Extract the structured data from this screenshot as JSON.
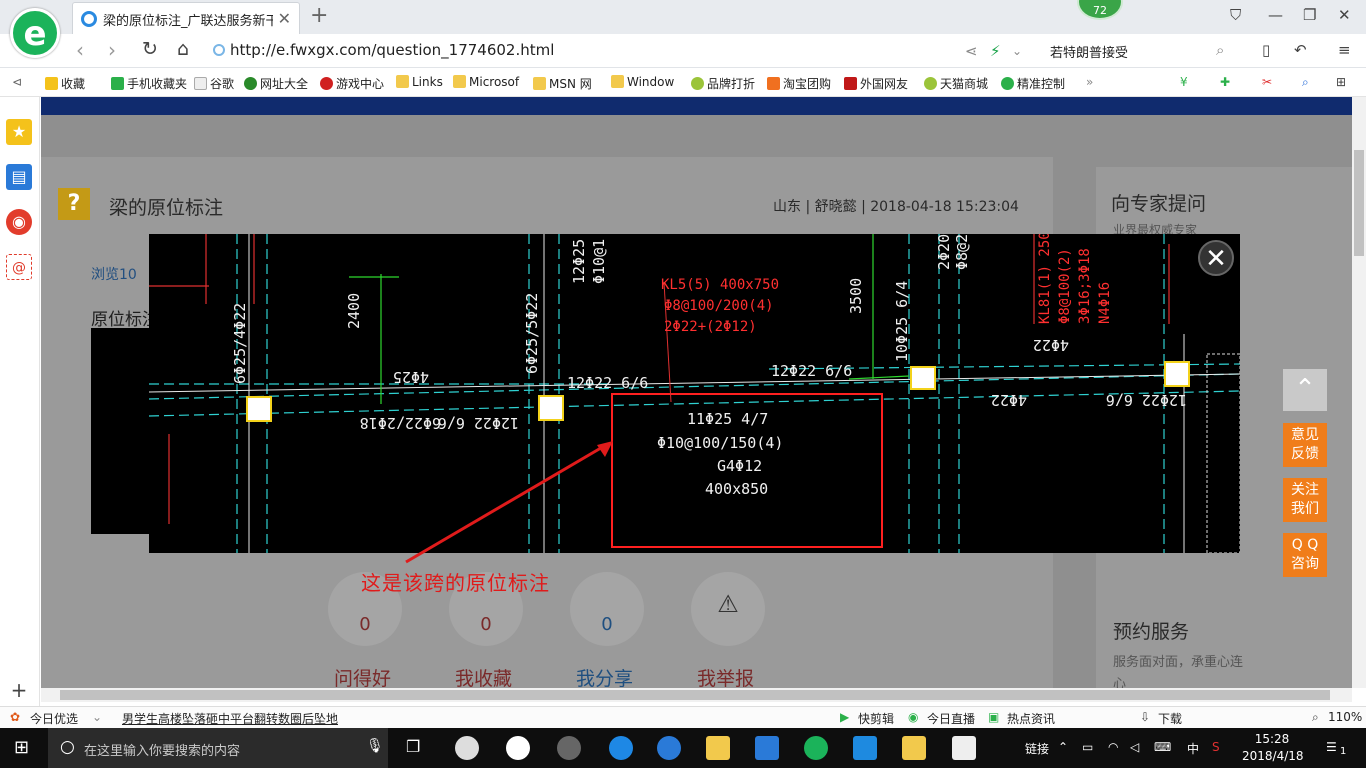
{
  "tab": {
    "title": "梁的原位标注_广联达服务新干线",
    "close": "✕",
    "new": "+"
  },
  "badge": "72",
  "address": {
    "url": "http://e.fwxgx.com/question_1774602.html",
    "search": "若特朗普接受"
  },
  "bookmarks": [
    "收藏",
    "手机收藏夹",
    "谷歌",
    "网址大全",
    "游戏中心",
    "Links",
    "Microsof",
    "MSN 网",
    "Window",
    "品牌打折",
    "淘宝团购",
    "外国网友",
    "天猫商城",
    "精准控制"
  ],
  "question": {
    "title": "梁的原位标注",
    "meta": "山东 | 舒晓懿 | 2018-04-18 15:23:04",
    "views": "浏览10",
    "section": "原位标注"
  },
  "actions": [
    {
      "label": "问得好",
      "count": "0"
    },
    {
      "label": "我收藏",
      "count": "0"
    },
    {
      "label": "我分享",
      "count": "0"
    },
    {
      "label": "我举报",
      "count": ""
    }
  ],
  "right": {
    "expert": "向专家提问",
    "expert_sub": "业界最权威专家",
    "booking": "预约服务",
    "booking_sub": "服务面对面，承重心连心"
  },
  "floats": [
    "意见\n反馈",
    "关注\n我们",
    "Q Q\n咨询"
  ],
  "viewer": {
    "close": "✕",
    "caption": "这是该跨的原位标注",
    "annotations": {
      "box1": "11Φ25 4/7",
      "box2": "Φ10@100/150(4)",
      "box3": "G4Φ12",
      "box4": "400x850",
      "kl1": "KL5(5) 400x750",
      "kl2": "Φ8@100/200(4)",
      "kl3": "2Φ22+(2Φ12)",
      "t1": "12Φ22 6/6",
      "t2": "12Φ22 6/6",
      "t3": "3500",
      "t4": "2400",
      "t5": "6Φ25/5Φ22",
      "t6": "6Φ25/4Φ22",
      "t7": "12Φ22 6/6",
      "t8": "6Φ22/2Φ18",
      "t9": "4Φ25",
      "t10": "10Φ25 6/4",
      "t11": "4Φ22",
      "t12": "12Φ22 6/6",
      "t13": "4Φ22",
      "t14": "KL81(1) 250",
      "t15": "Φ8@100(2)",
      "t16": "3Φ16;3Φ18",
      "t17": "N4Φ16",
      "t18": "12Φ25",
      "t19": "Φ10@1",
      "t20": "2Φ20",
      "t21": "Φ8@2"
    }
  },
  "status": {
    "news": "今日优选",
    "headline": "男学生高楼坠落砸中平台翻转数圈后坠地",
    "items": [
      "快剪辑",
      "今日直播",
      "热点资讯",
      "下载"
    ],
    "zoom": "110%"
  },
  "taskbar": {
    "search": "在这里输入你要搜索的内容",
    "link": "链接",
    "ime": "中",
    "time": "15:28",
    "date": "2018/4/18",
    "notif": "1"
  }
}
